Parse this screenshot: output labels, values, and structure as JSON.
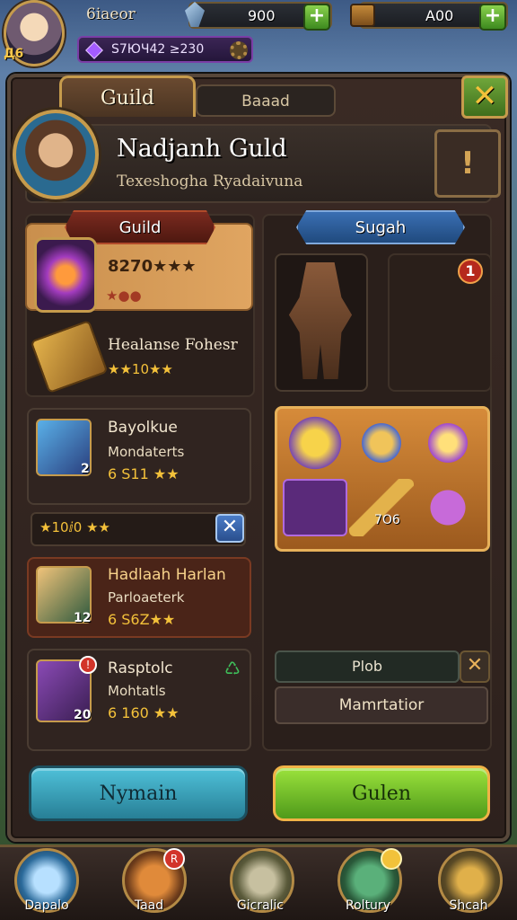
{
  "player": {
    "name": "6iaeor",
    "level": "Д6",
    "gems": "S7ЮЧ42 ≥230"
  },
  "resources": [
    {
      "icon": "crystal-icon",
      "value": "900"
    },
    {
      "icon": "chest-icon",
      "value": "A00"
    }
  ],
  "tabs": {
    "active": "Guild",
    "other": "Baaad"
  },
  "guild": {
    "name": "Nadjanh Guld",
    "subtitle": "Texeshoghа Ryadaivuna"
  },
  "ribbons": {
    "left": "Guild",
    "right": "Sugah"
  },
  "left_items": {
    "top": {
      "value": "8270★★★",
      "dots": "★●●"
    },
    "second": {
      "title": "Healanse Fohesr",
      "stars": "★★10★★"
    }
  },
  "members": [
    {
      "name": "Bayolkue",
      "role": "Mondaterts",
      "meta": "6 S11 ★★",
      "badge": "2"
    },
    {
      "name": "Hadlaah Harlan",
      "role": "Parloaeterk",
      "meta": "6 S6Z★★",
      "badge": "12"
    },
    {
      "name": "Rasptolc",
      "role": "Mohtatls",
      "meta": "6 160 ★★",
      "badge": "20"
    }
  ],
  "bar": {
    "text": "★10ⅈ0 ★★"
  },
  "right": {
    "badge": "1",
    "grid_label": "7О6",
    "plob": "Plob",
    "mem": "Mamrtatior"
  },
  "buttons": {
    "primary": "Nymain",
    "secondary": "Gulen"
  },
  "nav": [
    {
      "label": "Dapalo",
      "icon": "crystal-icon"
    },
    {
      "label": "Taad",
      "icon": "chest-icon",
      "badge": "R"
    },
    {
      "label": "Gicralic",
      "icon": "lantern-icon"
    },
    {
      "label": "Roltury",
      "icon": "treasure-icon"
    },
    {
      "label": "Shcah",
      "icon": "gear-icon"
    }
  ],
  "colors": {
    "gold": "#c69b4c",
    "green": "#6fa63a",
    "blue": "#3a6fb3"
  }
}
